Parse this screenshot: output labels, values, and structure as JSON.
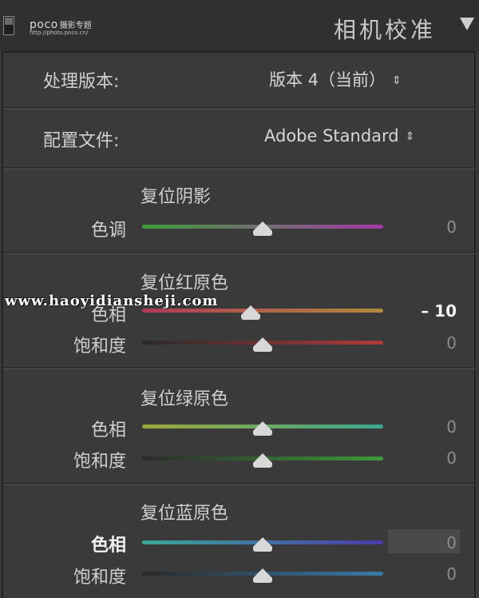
{
  "header": {
    "logo_brand": "poco",
    "logo_sub": "摄影专题",
    "logo_url": "http://photo.poco.cn/",
    "title": "相机校准"
  },
  "process": {
    "label": "处理版本:",
    "value": "版本 4（当前）"
  },
  "profile": {
    "label": "配置文件:",
    "value": "Adobe Standard"
  },
  "shadows": {
    "title": "复位阴影",
    "tint": {
      "label": "色调",
      "value": "0",
      "fraction": 0.5
    }
  },
  "red": {
    "title": "复位红原色",
    "hue": {
      "label": "色相",
      "value": "– 10",
      "fraction": 0.45
    },
    "saturation": {
      "label": "饱和度",
      "value": "0",
      "fraction": 0.5
    }
  },
  "green": {
    "title": "复位绿原色",
    "hue": {
      "label": "色相",
      "value": "0",
      "fraction": 0.5
    },
    "saturation": {
      "label": "饱和度",
      "value": "0",
      "fraction": 0.5
    }
  },
  "blue": {
    "title": "复位蓝原色",
    "hue": {
      "label": "色相",
      "value": "0",
      "fraction": 0.5
    },
    "saturation": {
      "label": "饱和度",
      "value": "0",
      "fraction": 0.5
    }
  },
  "watermark": "www.haoyidiansheji.com",
  "colors": {
    "tint_gradient": [
      "#3f9e3a",
      "#a33aa6"
    ],
    "red_hue_gradient": [
      "#b03a58",
      "#b08a3a"
    ],
    "red_sat_gradient": [
      "#2a2a2a",
      "#b03a3a"
    ],
    "green_hue_gradient": [
      "#9ea83a",
      "#3aa88e"
    ],
    "green_sat_gradient": [
      "#2a2a2a",
      "#3e9a3a"
    ],
    "blue_hue_gradient": [
      "#3aa89a",
      "#4a3aa8"
    ],
    "blue_sat_gradient": [
      "#2a2a2a",
      "#3a7aa8"
    ]
  },
  "icons": {
    "toggle": "panel-toggle-icon",
    "collapse": "triangle-down-icon",
    "updown": "up-down-arrows-icon"
  }
}
